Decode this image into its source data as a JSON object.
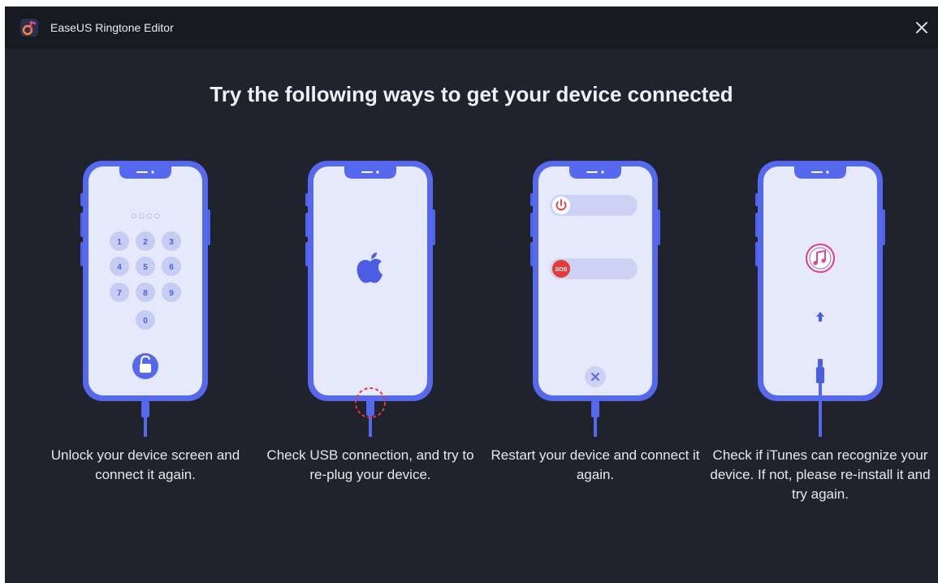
{
  "window": {
    "title": "EaseUS Ringtone Editor",
    "app_icon": "music-note-logo-icon",
    "close_icon": "close-icon",
    "colors": {
      "background": "#20232c",
      "titlebar": "#171a21",
      "accent": "#5568ee",
      "text": "#e6e8ee"
    }
  },
  "heading": "Try the following ways to get your device connected",
  "steps": [
    {
      "caption": "Unlock your device screen and connect it again.",
      "illustration": "phone-passcode-keypad",
      "keypad": {
        "dots": "○ ○ ○ ○",
        "keys": [
          "1",
          "2",
          "3",
          "4",
          "5",
          "6",
          "7",
          "8",
          "9",
          "0"
        ],
        "unlock_icon": "unlock-padlock-icon"
      }
    },
    {
      "caption": "Check USB connection, and try to re-plug your device.",
      "illustration": "phone-apple-logo",
      "icons": [
        "apple-logo-icon",
        "usb-port-highlight-icon"
      ]
    },
    {
      "caption": "Restart your device and connect it again.",
      "illustration": "phone-power-off-slider",
      "sos_label": "SOS",
      "icons": [
        "power-icon",
        "sos-icon",
        "cancel-x-icon"
      ]
    },
    {
      "caption": "Check if iTunes can recognize your device. If not, please re-install it and try again.",
      "illustration": "phone-itunes-upload",
      "icons": [
        "itunes-logo-icon",
        "upload-arrow-icon",
        "lightning-cable-icon"
      ]
    }
  ]
}
